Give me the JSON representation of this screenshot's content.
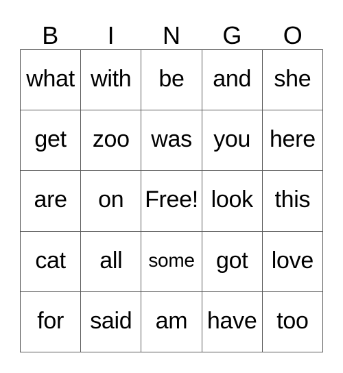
{
  "card": {
    "header": [
      "B",
      "I",
      "N",
      "G",
      "O"
    ],
    "rows": [
      [
        "what",
        "with",
        "be",
        "and",
        "she"
      ],
      [
        "get",
        "zoo",
        "was",
        "you",
        "here"
      ],
      [
        "are",
        "on",
        "Free!",
        "look",
        "this"
      ],
      [
        "cat",
        "all",
        "some",
        "got",
        "love"
      ],
      [
        "for",
        "said",
        "am",
        "have",
        "too"
      ]
    ],
    "free_space": "Free!",
    "colors": {
      "text": "#000000",
      "grid_line": "#5a5a5a",
      "background": "#ffffff"
    }
  }
}
